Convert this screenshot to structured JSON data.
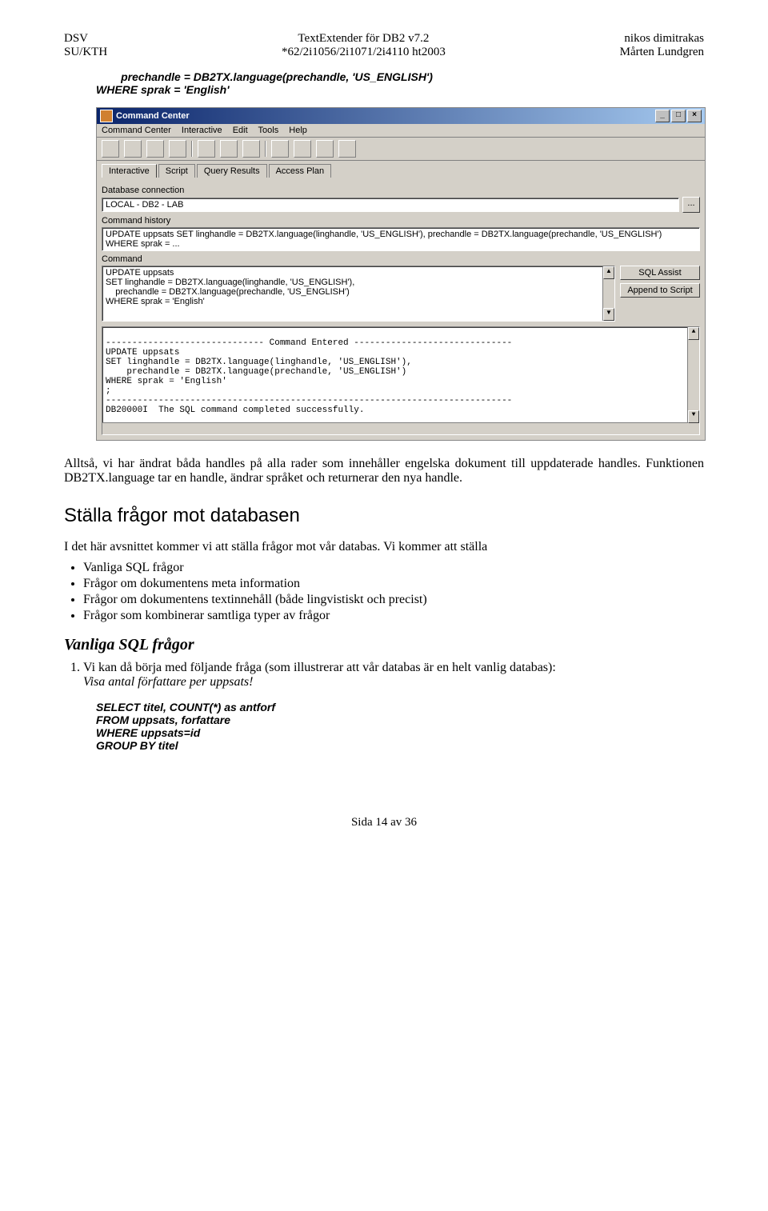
{
  "header": {
    "left_line1": "DSV",
    "left_line2": "SU/KTH",
    "center_line1": "TextExtender för DB2 v7.2",
    "center_line2": "*62/2i1056/2i1071/2i4110 ht2003",
    "right_line1": "nikos dimitrakas",
    "right_line2": "Mårten Lundgren"
  },
  "code_before": "        prechandle = DB2TX.language(prechandle, 'US_ENGLISH')\nWHERE sprak = 'English'",
  "app": {
    "title": "Command Center",
    "menus": [
      "Command Center",
      "Interactive",
      "Edit",
      "Tools",
      "Help"
    ],
    "tabs": [
      "Interactive",
      "Script",
      "Query Results",
      "Access Plan"
    ],
    "labels": {
      "db_connection": "Database connection",
      "command_history": "Command history",
      "command": "Command"
    },
    "db_value": "LOCAL - DB2 - LAB",
    "history_value": "UPDATE uppsats SET linghandle = DB2TX.language(linghandle, 'US_ENGLISH'),   prechandle = DB2TX.language(prechandle, 'US_ENGLISH') WHERE sprak = ...",
    "command_text": "UPDATE uppsats\nSET linghandle = DB2TX.language(linghandle, 'US_ENGLISH'),\n    prechandle = DB2TX.language(prechandle, 'US_ENGLISH')\nWHERE sprak = 'English'",
    "buttons": {
      "sql_assist": "SQL Assist",
      "append": "Append to Script"
    },
    "output_text": "\n------------------------------ Command Entered ------------------------------\nUPDATE uppsats\nSET linghandle = DB2TX.language(linghandle, 'US_ENGLISH'),\n    prechandle = DB2TX.language(prechandle, 'US_ENGLISH')\nWHERE sprak = 'English'\n;\n-----------------------------------------------------------------------------\nDB20000I  The SQL command completed successfully."
  },
  "para_after_app": "Alltså, vi har ändrat båda handles på alla rader som innehåller engelska dokument till uppdaterade handles. Funktionen DB2TX.language tar en handle, ändrar språket och returnerar den nya handle.",
  "section_title": "Ställa frågor mot databasen",
  "section_intro": "I det här avsnittet kommer vi att ställa frågor mot vår databas. Vi kommer att ställa",
  "bullets": [
    "Vanliga SQL frågor",
    "Frågor om dokumentens meta information",
    "Frågor om dokumentens textinnehåll (både lingvistiskt och precist)",
    "Frågor som kombinerar samtliga typer av frågor"
  ],
  "subhead": "Vanliga SQL frågor",
  "numbered_intro": "Vi kan då börja med följande fråga (som illustrerar att vår databas är en helt vanlig databas):",
  "numbered_italic": "Visa antal författare per uppsats!",
  "code_bottom": "SELECT titel, COUNT(*) as antforf\nFROM uppsats, forfattare\nWHERE uppsats=id\nGROUP BY titel",
  "footer": "Sida 14 av 36"
}
